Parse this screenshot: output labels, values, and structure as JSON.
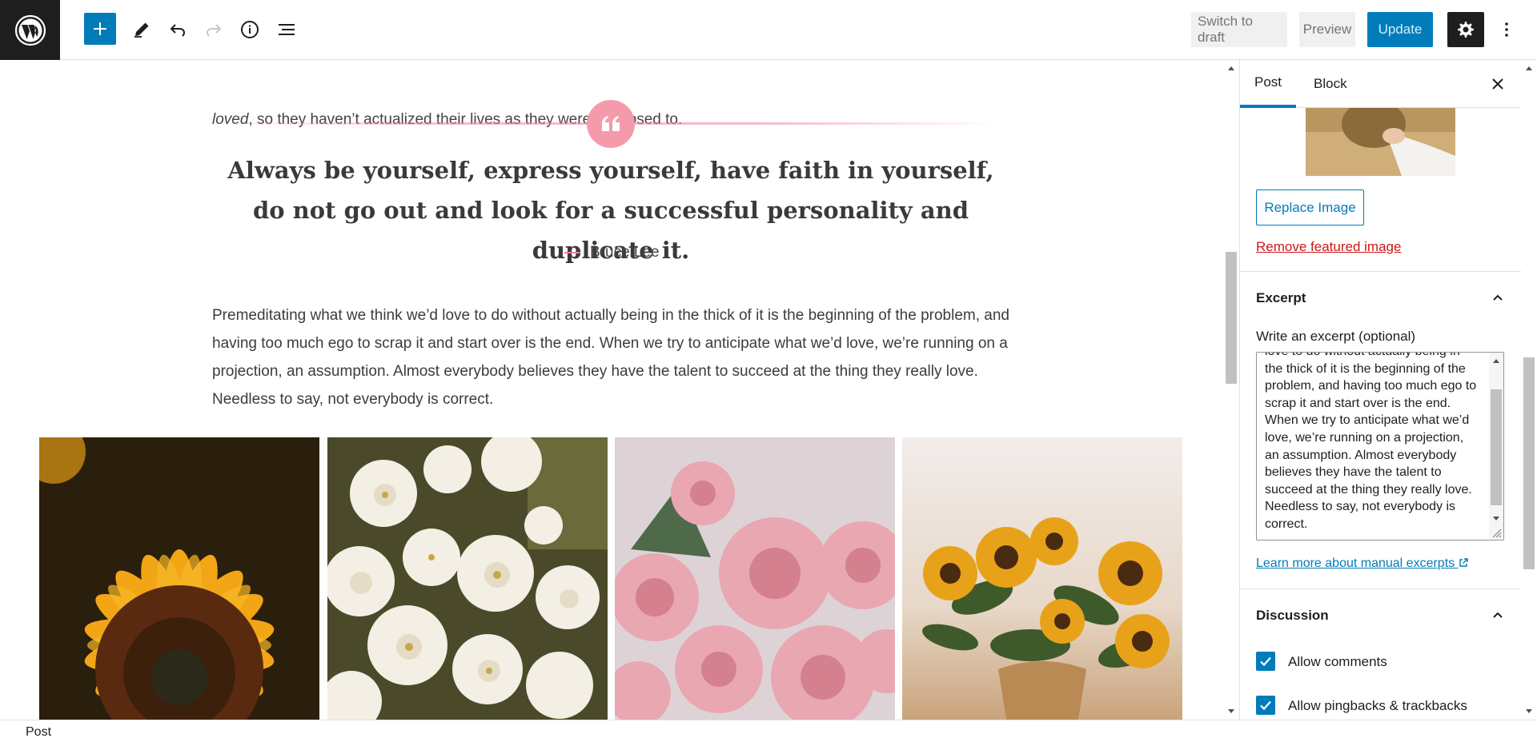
{
  "toolbar": {
    "switch_to_draft": "Switch to draft",
    "preview": "Preview",
    "update": "Update"
  },
  "content": {
    "top_line_em": "loved",
    "top_line_rest": ", so they haven’t actualized their lives as they were supposed to.",
    "quote": "Always be yourself, express yourself, have faith in yourself, do not go out and look for a successful personality and duplicate it.",
    "citation": "Bruce Lee",
    "paragraph": "Premeditating what we think we’d love to do without actually being in the thick of it is the beginning of the problem, and having too much ego to scrap it and start over is the end. When we try to anticipate what we’d love, we’re running on a projection, an assumption. Almost everybody believes they have the talent to succeed at the thing they really love. Needless to say, not everybody is correct."
  },
  "sidebar": {
    "tabs": [
      "Post",
      "Block"
    ],
    "replace_image": "Replace Image",
    "remove_featured_image": "Remove featured image",
    "excerpt_title": "Excerpt",
    "excerpt_label": "Write an excerpt (optional)",
    "excerpt_value": "love to do without actually being in the thick of it is the beginning of the problem, and having too much ego to scrap it and start over is the end. When we try to anticipate what we’d love, we’re running on a projection, an assumption. Almost everybody believes they have the talent to succeed at the thing they really love. Needless to say, not everybody is correct.",
    "learn_more": "Learn more about manual excerpts",
    "discussion_title": "Discussion",
    "allow_comments": "Allow comments",
    "allow_pingbacks": "Allow pingbacks & trackbacks"
  },
  "footer": {
    "breadcrumb": "Post"
  },
  "colors": {
    "accent": "#007cba",
    "quote_pink": "#f59aab",
    "danger": "#cc1818"
  },
  "icons": [
    "wordpress-logo-icon",
    "plus-icon",
    "pencil-icon",
    "undo-icon",
    "redo-icon",
    "info-icon",
    "list-view-icon",
    "gear-icon",
    "more-vertical-icon",
    "close-icon",
    "chevron-up-icon",
    "quote-icon",
    "check-icon",
    "external-link-icon"
  ]
}
